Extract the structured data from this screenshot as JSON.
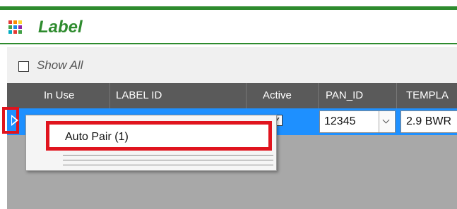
{
  "header": {
    "title": "Label",
    "icon": "grid-icon",
    "accent_color": "#2e8b2e"
  },
  "filters": {
    "show_all_label": "Show All",
    "show_all_checked": false
  },
  "grid": {
    "columns": [
      "In Use",
      "LABEL ID",
      "Active",
      "PAN_ID",
      "TEMPLA"
    ],
    "rows": [
      {
        "in_use": "",
        "label_id": "",
        "active": true,
        "pan_id": "12345",
        "template": "2.9 BWR"
      }
    ],
    "selection_color": "#1e90ff"
  },
  "context_menu": {
    "items": [
      {
        "label": "Auto Pair (1)"
      }
    ],
    "highlight_color": "#e0141e"
  }
}
